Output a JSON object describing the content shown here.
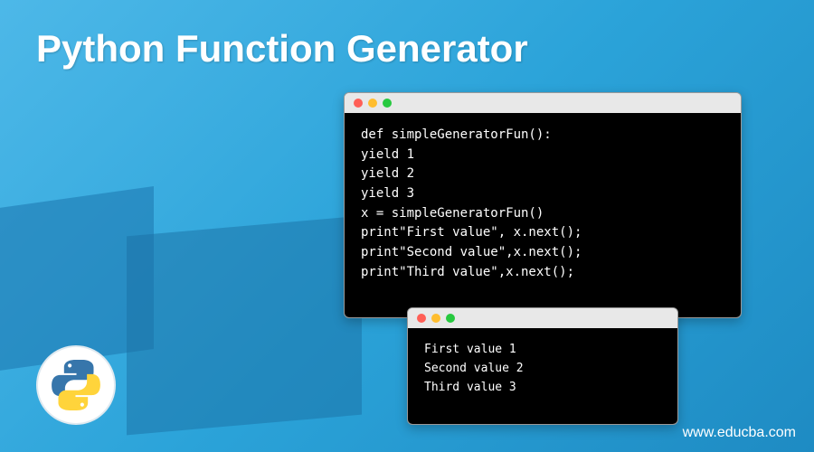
{
  "title": "Python Function Generator",
  "code_window": {
    "lines": [
      "def simpleGeneratorFun():",
      "yield 1",
      "yield 2",
      "yield 3",
      "x = simpleGeneratorFun()",
      "print\"First value\", x.next();",
      "print\"Second value\",x.next();",
      "print\"Third value\",x.next();"
    ]
  },
  "output_window": {
    "lines": [
      "First value 1",
      "Second value 2",
      "Third value 3"
    ]
  },
  "footer": {
    "url": "www.educba.com"
  },
  "logo": {
    "name": "python-logo"
  }
}
